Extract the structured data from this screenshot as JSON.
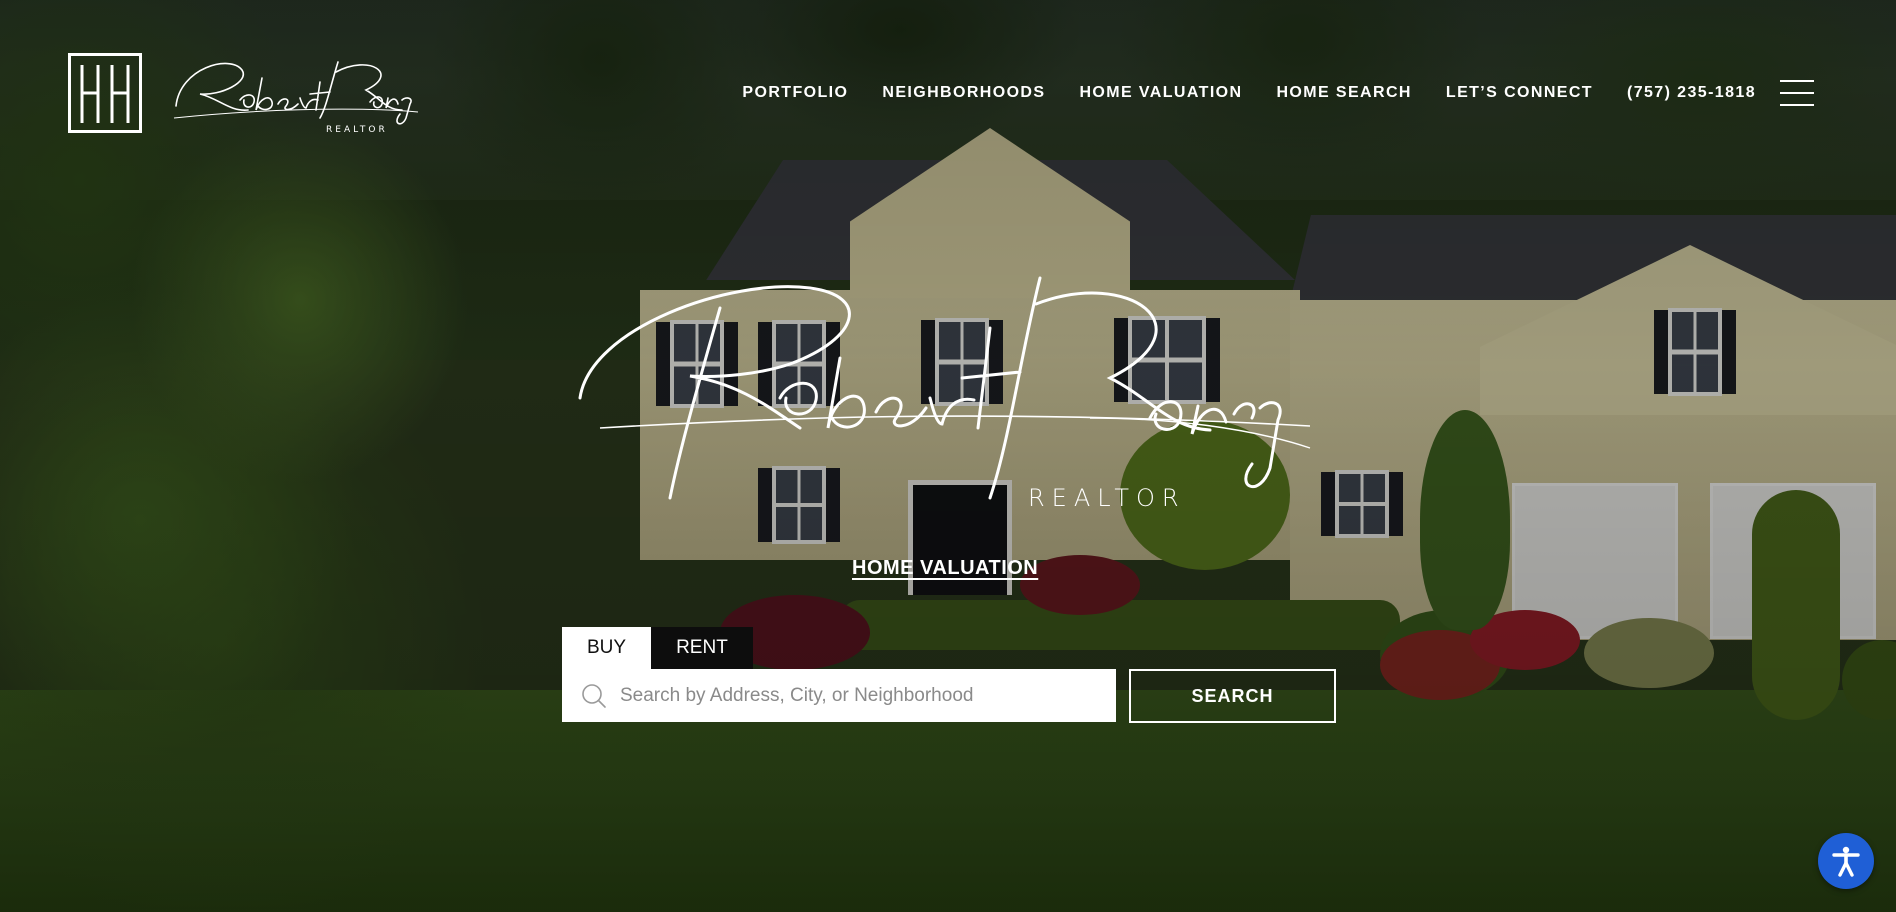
{
  "brand": {
    "logo_script": "Robert Ramey",
    "logo_sub": "REALTOR",
    "monogram": "RR"
  },
  "nav": {
    "items": [
      {
        "label": "PORTFOLIO"
      },
      {
        "label": "NEIGHBORHOODS"
      },
      {
        "label": "HOME VALUATION"
      },
      {
        "label": "HOME SEARCH"
      },
      {
        "label": "LET’S CONNECT"
      },
      {
        "label": "(757) 235-1818"
      }
    ],
    "menu_icon": "hamburger-menu-icon"
  },
  "hero": {
    "logo_script": "Robert Ramey",
    "logo_sub": "REALTOR",
    "link_label": "HOME VALUATION"
  },
  "search": {
    "tabs": [
      {
        "label": "BUY",
        "active": true
      },
      {
        "label": "RENT",
        "active": false
      }
    ],
    "placeholder": "Search by Address, City, or Neighborhood",
    "value": "",
    "button_label": "SEARCH",
    "icon": "search-icon"
  },
  "accessibility": {
    "icon": "accessibility-icon"
  },
  "colors": {
    "text": "#ffffff",
    "accessibility_button": "#1f5fd6",
    "active_tab_bg": "#ffffff",
    "inactive_tab_bg": "#0d0d0d"
  }
}
